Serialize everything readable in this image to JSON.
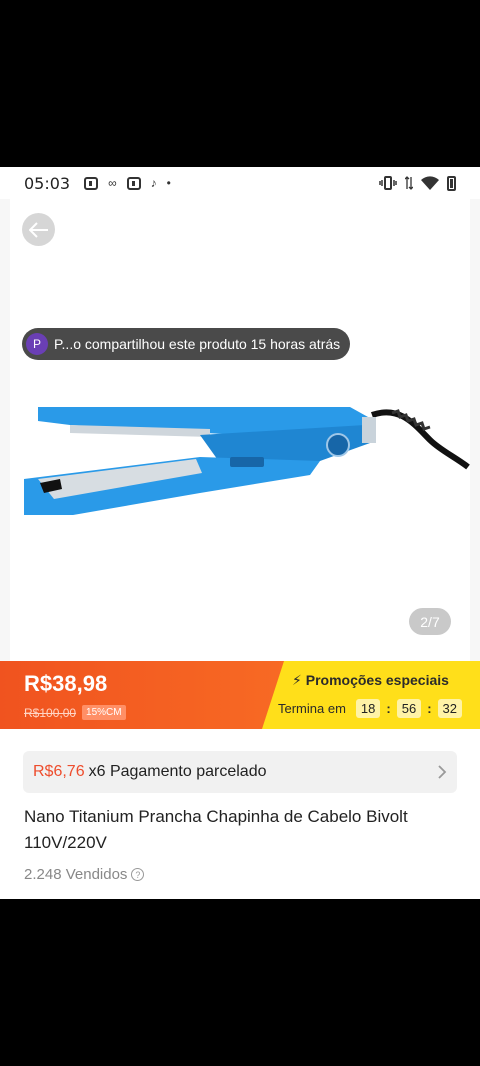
{
  "status_bar": {
    "time": "05:03"
  },
  "gallery": {
    "share_avatar_letter": "P",
    "share_text": "P...o compartilhou este produto 15 horas atrás",
    "page_indicator": "2/7"
  },
  "price": {
    "current": "R$38,98",
    "original": "R$100,00",
    "discount": "15%CM"
  },
  "promo": {
    "title": "Promoções especiais",
    "ends_label": "Termina em",
    "hours": "18",
    "minutes": "56",
    "seconds": "32"
  },
  "installment": {
    "amount": "R$6,76",
    "text": "x6 Pagamento parcelado"
  },
  "product": {
    "title": "Nano Titanium Prancha Chapinha de Cabelo Bivolt 110V/220V",
    "sold": "2.248 Vendidos"
  },
  "colors": {
    "accent": "#ee4d2d",
    "promo_yellow": "#ffdf1a",
    "product_blue": "#1e8fe0"
  }
}
